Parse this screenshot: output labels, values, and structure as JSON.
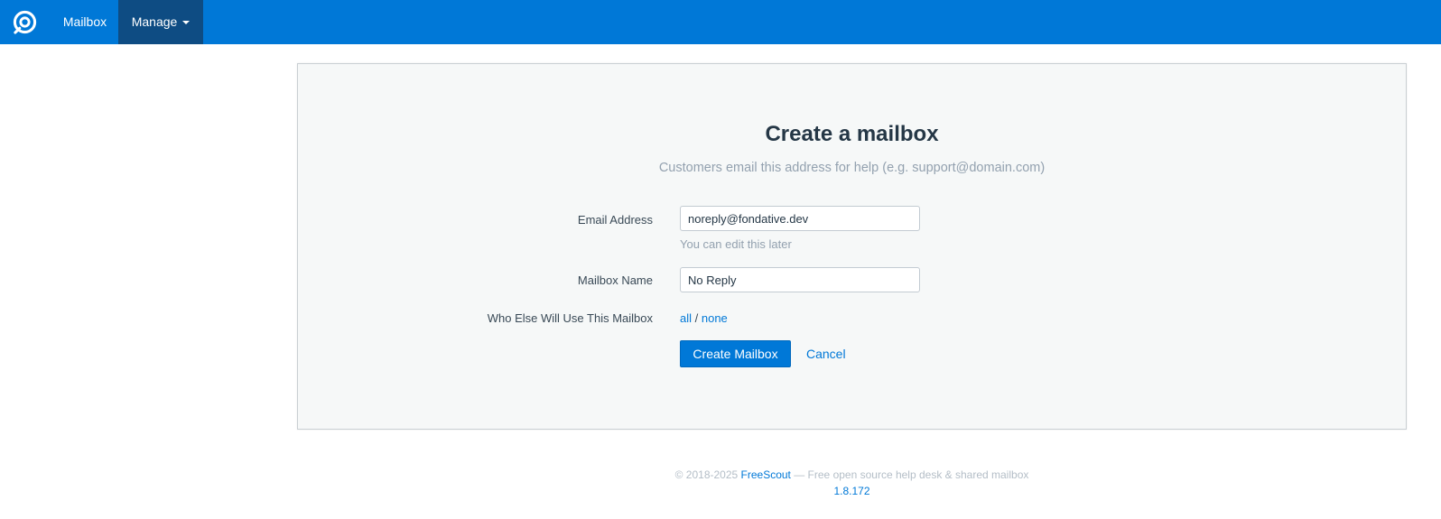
{
  "nav": {
    "mailbox_label": "Mailbox",
    "manage_label": "Manage",
    "brand_color": "#0078d7",
    "active_color": "#0e4c83"
  },
  "form": {
    "title": "Create a mailbox",
    "subtitle": "Customers email this address for help (e.g. support@domain.com)",
    "email_label": "Email Address",
    "email_value": "noreply@fondative.dev",
    "email_help": "You can edit this later",
    "name_label": "Mailbox Name",
    "name_value": "No Reply",
    "who_label": "Who Else Will Use This Mailbox",
    "who_all": "all",
    "who_separator": " / ",
    "who_none": "none",
    "create_button": "Create Mailbox",
    "cancel_link": "Cancel"
  },
  "footer": {
    "copyright": "© 2018-2025 ",
    "brand": "FreeScout",
    "tagline": " — Free open source help desk & shared mailbox",
    "version": "1.8.172"
  }
}
